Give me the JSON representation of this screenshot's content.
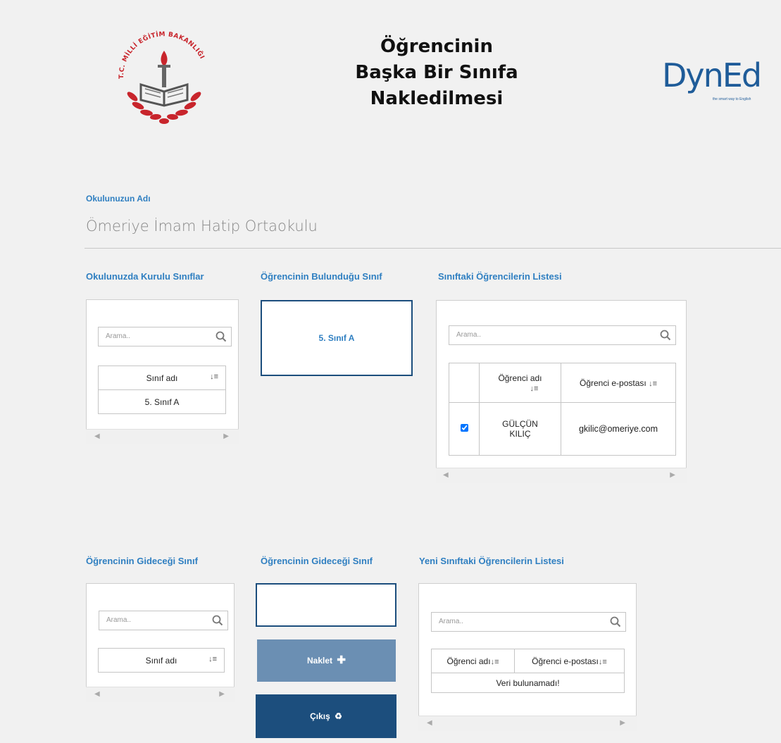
{
  "header": {
    "title_lines": [
      "Öğrencinin",
      "Başka Bir Sınıfa",
      "Nakledilmesi"
    ],
    "left_logo_icon": "meb-logo-icon",
    "right_logo_text": "DynEd",
    "right_logo_tagline": "the smart way to English"
  },
  "school": {
    "label": "Okulunuzun Adı",
    "name": "Ömeriye İmam Hatip Ortaokulu"
  },
  "section1": {
    "classes_label": "Okulunuzda Kurulu Sınıflar",
    "current_class_label": "Öğrencinin Bulunduğu Sınıf",
    "students_label": "Sınıftaki Öğrencilerin Listesi",
    "classes_search_placeholder": "Arama..",
    "classes_column": "Sınıf adı",
    "classes_rows": [
      "5. Sınıf A"
    ],
    "current_class_value": "5. Sınıf A",
    "students_search_placeholder": "Arama..",
    "students_col_name": "Öğrenci adı",
    "students_col_email": "Öğrenci e-postası",
    "students_rows": [
      {
        "checked": true,
        "name_line1": "GÜLÇÜN",
        "name_line2": "KILIÇ",
        "email": "gkilic@omeriye.com"
      }
    ]
  },
  "section2": {
    "target_classes_label": "Öğrencinin Gideceği Sınıf",
    "target_class_label": "Öğrencinin Gideceği Sınıf",
    "new_students_label": "Yeni Sınıftaki Öğrencilerin Listesi",
    "target_search_placeholder": "Arama..",
    "target_column": "Sınıf adı",
    "target_class_value": "",
    "naklet_button": "Naklet",
    "cikis_button": "Çıkış",
    "new_students_search_placeholder": "Arama..",
    "new_students_col_name": "Öğrenci adı",
    "new_students_col_email": "Öğrenci e-postası",
    "empty_message": "Veri bulunamadı!"
  },
  "colors": {
    "accent_blue": "#2f7fc1",
    "dark_blue": "#1c4e7d",
    "button_light": "#6b8fb3",
    "logo_red": "#c8252c"
  }
}
